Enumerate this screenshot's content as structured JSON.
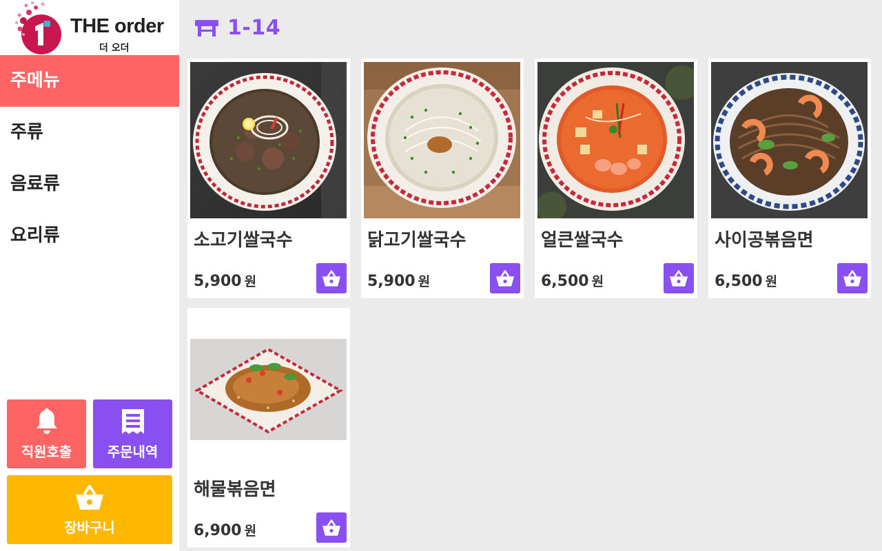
{
  "brand": {
    "title": "THE order",
    "subtitle": "더 오더"
  },
  "sidebar": {
    "categories": [
      {
        "label": "주메뉴",
        "active": true
      },
      {
        "label": "주류",
        "active": false
      },
      {
        "label": "음료류",
        "active": false
      },
      {
        "label": "요리류",
        "active": false
      }
    ],
    "staff_call": {
      "label": "직원호출",
      "icon": "bell-icon"
    },
    "order_history": {
      "label": "주문내역",
      "icon": "receipt-icon"
    },
    "cart": {
      "label": "장바구니",
      "icon": "basket-icon"
    }
  },
  "table": {
    "icon": "table-icon",
    "number": "1-14"
  },
  "menu_items": [
    {
      "name": "소고기쌀국수",
      "price": "5,900",
      "currency": "원"
    },
    {
      "name": "닭고기쌀국수",
      "price": "5,900",
      "currency": "원"
    },
    {
      "name": "얼큰쌀국수",
      "price": "6,500",
      "currency": "원"
    },
    {
      "name": "사이공볶음면",
      "price": "6,500",
      "currency": "원"
    },
    {
      "name": "해물볶음면",
      "price": "6,900",
      "currency": "원"
    }
  ],
  "colors": {
    "accent_purple": "#8a4ff0",
    "accent_coral": "#fe6464",
    "accent_yellow": "#ffb800",
    "background": "#ebebeb"
  }
}
